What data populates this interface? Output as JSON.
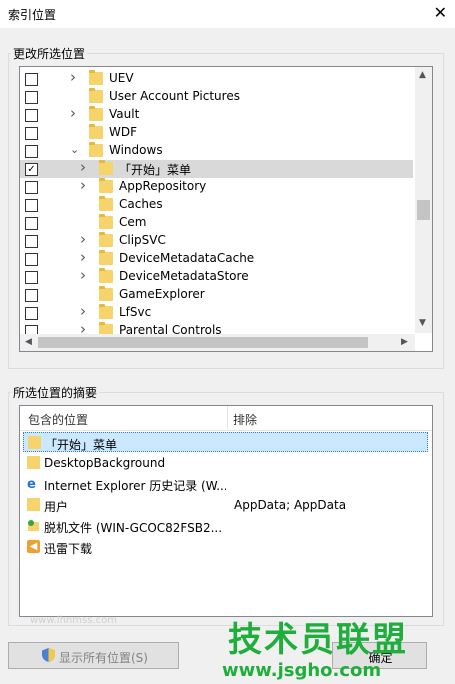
{
  "window": {
    "title": "索引位置"
  },
  "group_change": {
    "label": "更改所选位置"
  },
  "tree_items": [
    {
      "label": "UEV",
      "checked": false,
      "expand": "collapsed",
      "indent": 1,
      "selected": false
    },
    {
      "label": "User Account Pictures",
      "checked": false,
      "expand": "none",
      "indent": 1,
      "selected": false
    },
    {
      "label": "Vault",
      "checked": false,
      "expand": "collapsed",
      "indent": 1,
      "selected": false
    },
    {
      "label": "WDF",
      "checked": false,
      "expand": "none",
      "indent": 1,
      "selected": false
    },
    {
      "label": "Windows",
      "checked": false,
      "expand": "expanded",
      "indent": 1,
      "selected": false
    },
    {
      "label": "「开始」菜单",
      "checked": true,
      "expand": "collapsed",
      "indent": 2,
      "selected": true
    },
    {
      "label": "AppRepository",
      "checked": false,
      "expand": "collapsed",
      "indent": 2,
      "selected": false
    },
    {
      "label": "Caches",
      "checked": false,
      "expand": "none",
      "indent": 2,
      "selected": false
    },
    {
      "label": "Cem",
      "checked": false,
      "expand": "none",
      "indent": 2,
      "selected": false
    },
    {
      "label": "ClipSVC",
      "checked": false,
      "expand": "collapsed",
      "indent": 2,
      "selected": false
    },
    {
      "label": "DeviceMetadataCache",
      "checked": false,
      "expand": "collapsed",
      "indent": 2,
      "selected": false
    },
    {
      "label": "DeviceMetadataStore",
      "checked": false,
      "expand": "collapsed",
      "indent": 2,
      "selected": false
    },
    {
      "label": "GameExplorer",
      "checked": false,
      "expand": "none",
      "indent": 2,
      "selected": false
    },
    {
      "label": "LfSvc",
      "checked": false,
      "expand": "collapsed",
      "indent": 2,
      "selected": false
    },
    {
      "label": "Parental Controls",
      "checked": false,
      "expand": "collapsed",
      "indent": 2,
      "selected": false
    }
  ],
  "group_summary": {
    "label": "所选位置的摘要"
  },
  "summary": {
    "col_included": "包含的位置",
    "col_excluded": "排除",
    "rows": [
      {
        "name": "「开始」菜单",
        "exclude": "",
        "icon": "folder-icon",
        "selected": true
      },
      {
        "name": "DesktopBackground",
        "exclude": "",
        "icon": "folder-icon",
        "selected": false
      },
      {
        "name": "Internet Explorer 历史记录 (W...",
        "exclude": "",
        "icon": "internet-explorer-icon",
        "selected": false
      },
      {
        "name": "用户",
        "exclude": "AppData; AppData",
        "icon": "folder-icon",
        "selected": false
      },
      {
        "name": "脱机文件 (WIN-GCOC82FSB2...",
        "exclude": "",
        "icon": "offline-files-icon",
        "selected": false
      },
      {
        "name": "迅雷下载",
        "exclude": "",
        "icon": "thunder-download-icon",
        "selected": false
      }
    ]
  },
  "buttons": {
    "show_all": "显示所有位置(S)",
    "ok": "确定"
  },
  "watermark": {
    "main": "技术员联盟",
    "url": "www.jsgho.com",
    "faint": "www.lhnmss.com"
  },
  "colors": {
    "folder": "#f6d36b",
    "selected_row": "#cce8ff",
    "watermark": "#1fae3b"
  }
}
